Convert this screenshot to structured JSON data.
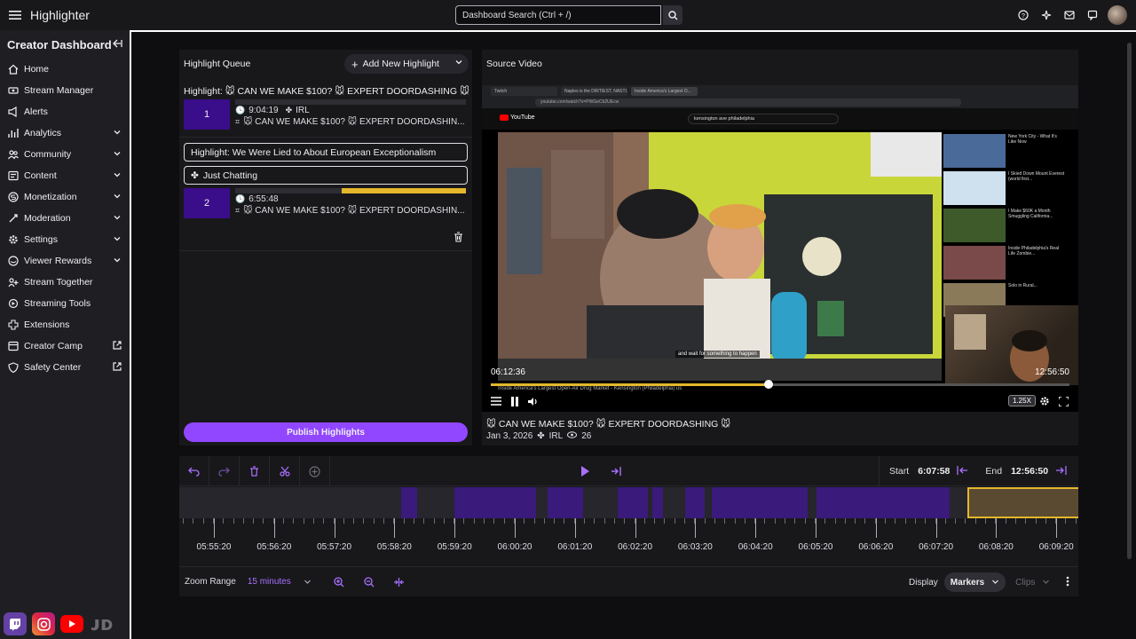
{
  "app": {
    "title": "Highlighter"
  },
  "search": {
    "placeholder": "Dashboard Search (Ctrl + /)"
  },
  "topbar_icons": [
    "help-icon",
    "sparkle-icon",
    "inbox-icon",
    "whispers-icon",
    "avatar"
  ],
  "sidebar": {
    "title": "Creator Dashboard",
    "items": [
      {
        "label": "Home",
        "icon": "home-icon",
        "expandable": false,
        "external": false
      },
      {
        "label": "Stream Manager",
        "icon": "stream-icon",
        "expandable": false,
        "external": false
      },
      {
        "label": "Alerts",
        "icon": "alerts-icon",
        "expandable": false,
        "external": false
      },
      {
        "label": "Analytics",
        "icon": "analytics-icon",
        "expandable": true,
        "external": false
      },
      {
        "label": "Community",
        "icon": "community-icon",
        "expandable": true,
        "external": false
      },
      {
        "label": "Content",
        "icon": "content-icon",
        "expandable": true,
        "external": false
      },
      {
        "label": "Monetization",
        "icon": "monetization-icon",
        "expandable": true,
        "external": false
      },
      {
        "label": "Moderation",
        "icon": "moderation-icon",
        "expandable": true,
        "external": false
      },
      {
        "label": "Settings",
        "icon": "settings-icon",
        "expandable": true,
        "external": false
      },
      {
        "label": "Viewer Rewards",
        "icon": "rewards-icon",
        "expandable": true,
        "external": false
      },
      {
        "label": "Stream Together",
        "icon": "stream-together-icon",
        "expandable": false,
        "external": false
      },
      {
        "label": "Streaming Tools",
        "icon": "tools-icon",
        "expandable": false,
        "external": false
      },
      {
        "label": "Extensions",
        "icon": "extensions-icon",
        "expandable": false,
        "external": false
      },
      {
        "label": "Creator Camp",
        "icon": "creator-camp-icon",
        "expandable": false,
        "external": true
      },
      {
        "label": "Safety Center",
        "icon": "safety-icon",
        "expandable": false,
        "external": true
      }
    ]
  },
  "queue": {
    "title": "Highlight Queue",
    "add_label": "Add New Highlight",
    "highlight1": {
      "title": "Highlight: 🐭 CAN WE MAKE $100? 🐭 EXPERT DOORDASHING 🐭",
      "number": "1",
      "time": "9:04:19",
      "category": "IRL",
      "stream": "🐭 CAN WE MAKE $100? 🐭 EXPERT DOORDASHIN..."
    },
    "highlight2": {
      "title_input": "Highlight: We Were Lied to About European Exceptionalism",
      "category_input": "Just Chatting",
      "number": "2",
      "time": "6:55:48",
      "stream": "🐭 CAN WE MAKE $100? 🐭 EXPERT DOORDASHIN...",
      "selection_start": 0.46,
      "selection_end": 1.0
    },
    "publish_label": "Publish Highlights"
  },
  "source_video": {
    "title": "Source Video",
    "browser_tabs": [
      "Twitch",
      "Naples is the DIRTIEST, NASTI...",
      "Inside America's Largest O..."
    ],
    "address": "youtube.com/watch?v=PWGeCb2UEcw",
    "yt_search": "kensington ave philadelphia",
    "subtitle": "and wait for something to happen",
    "time_current": "06:12:36",
    "time_end": "12:56:50",
    "yt_caption": "Inside America's Largest Open-Air Drug Market - Kensington (Philadelphia) us",
    "progress": 0.48,
    "speed": "1.25X",
    "stream_title": "🐭 CAN WE MAKE $100? 🐭 EXPERT DOORDASHING 🐭",
    "date": "Jan 3, 2026",
    "category": "IRL",
    "viewers": "26",
    "related": [
      "New York City - What It's Like Now",
      "I Skied Down Mount Everest (world first...",
      "I Make $60K a Month Smuggling California...",
      "Inside Philadelphia's Real Life Zombie...",
      "Solo in Rural..."
    ]
  },
  "timeline": {
    "start_label": "Start",
    "start_value": "6:07:58",
    "end_label": "End",
    "end_value": "12:56:50",
    "ticks": [
      "05:55:20",
      "05:56:20",
      "05:57:20",
      "05:58:20",
      "05:59:20",
      "06:00:20",
      "06:01:20",
      "06:02:20",
      "06:03:20",
      "06:04:20",
      "06:05:20",
      "06:06:20",
      "06:07:20",
      "06:08:20",
      "06:09:20"
    ],
    "zoom_label": "Zoom Range",
    "zoom_value": "15 minutes",
    "display_label": "Display",
    "markers_label": "Markers",
    "clips_label": "Clips"
  },
  "colors": {
    "accent": "#9147ff",
    "accent_text": "#a970ff",
    "highlight_num_bg": "#3a0d8a",
    "selection": "#e5b72a"
  }
}
